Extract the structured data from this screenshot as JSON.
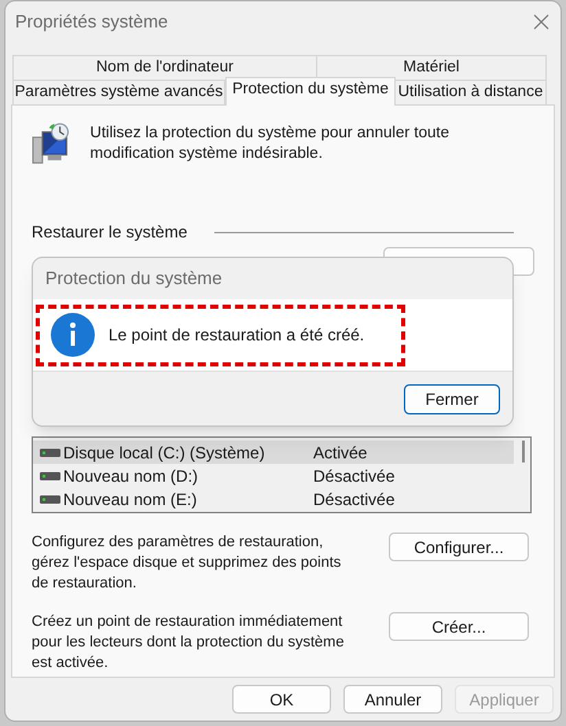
{
  "window": {
    "title": "Propriétés système"
  },
  "tab_rows": [
    {
      "tabs": [
        {
          "label": "Nom de l'ordinateur",
          "selected": false
        },
        {
          "label": "Matériel",
          "selected": false
        }
      ]
    },
    {
      "tabs": [
        {
          "label": "Paramètres système avancés",
          "selected": false
        },
        {
          "label": "Protection du système",
          "selected": true
        },
        {
          "label": "Utilisation à distance",
          "selected": false
        }
      ]
    }
  ],
  "intro": "Utilisez la protection du système pour annuler toute modification système indésirable.",
  "restore": {
    "heading": "Restaurer le système"
  },
  "drives": [
    {
      "name": "Disque local (C:) (Système)",
      "protection": "Activée",
      "selected": true
    },
    {
      "name": "Nouveau nom (D:)",
      "protection": "Désactivée",
      "selected": false
    },
    {
      "name": "Nouveau nom (E:)",
      "protection": "Désactivée",
      "selected": false
    }
  ],
  "configure": {
    "text": "Configurez des paramètres de restauration, gérez l'espace disque et supprimez des points de restauration.",
    "button": "Configurer..."
  },
  "create": {
    "text": "Créez un point de restauration immédiatement pour les lecteurs dont la protection du système est activée.",
    "button": "Créer..."
  },
  "buttons": [
    {
      "label": "OK",
      "disabled": false
    },
    {
      "label": "Annuler",
      "disabled": false
    },
    {
      "label": "Appliquer",
      "disabled": true
    }
  ],
  "dialog": {
    "title": "Protection du système",
    "message": "Le point de restauration a été créé.",
    "highlighted": true,
    "button": "Fermer"
  }
}
